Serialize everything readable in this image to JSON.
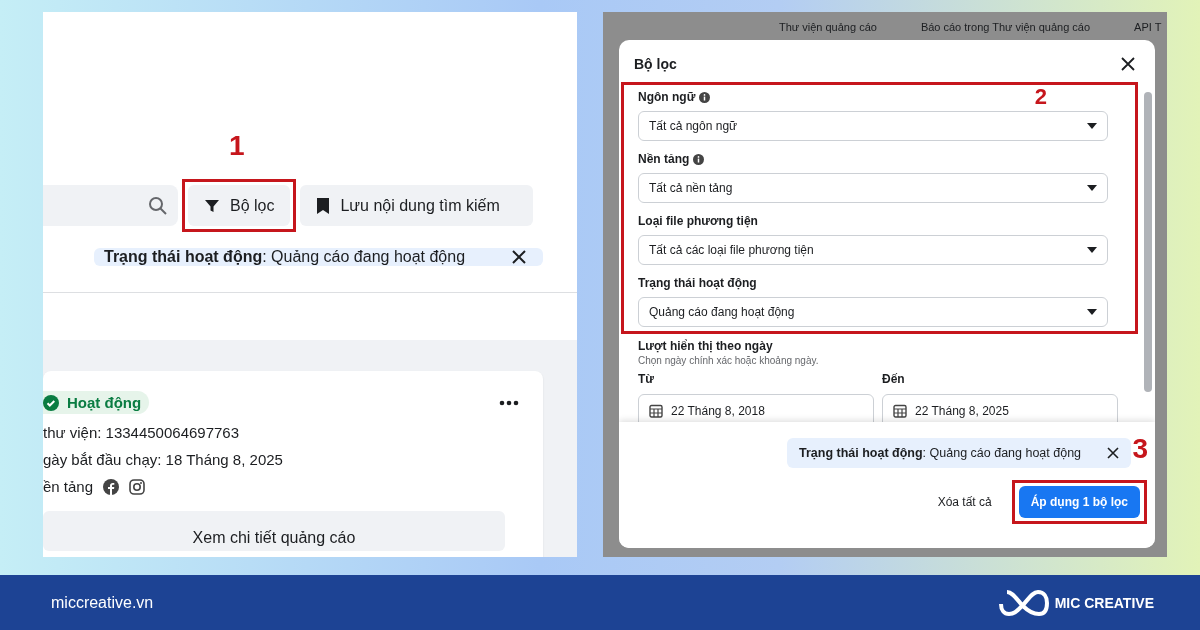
{
  "left_panel": {
    "filter_button": {
      "label": "Bộ lọc"
    },
    "save_search_button": {
      "label": "Lưu nội dung tìm kiếm"
    },
    "active_filter": {
      "text": "**Trạng thái hoạt động**: Quảng cáo đang hoạt động"
    },
    "ad_card": {
      "status": "Hoạt động",
      "library_id": "thư viện: 1334450064697763",
      "start_date": "gày bắt đầu chạy: 18 Tháng 8, 2025",
      "platforms_label": "ền tảng",
      "details_button": "Xem chi tiết quảng cáo"
    }
  },
  "right_panel": {
    "nav_links": [
      "Thư viện quảng cáo",
      "Báo cáo trong Thư viện quảng cáo",
      "API T"
    ],
    "modal": {
      "title": "Bộ lọc",
      "fields": [
        {
          "label": "Ngôn ngữ",
          "info": true,
          "value": "Tất cả ngôn ngữ"
        },
        {
          "label": "Nền tảng",
          "info": true,
          "value": "Tất cả nền tảng"
        },
        {
          "label": "Loại file phương tiện",
          "info": false,
          "value": "Tất cả các loại file phương tiện"
        },
        {
          "label": "Trạng thái hoạt động",
          "info": false,
          "value": "Quảng cáo đang hoạt động"
        }
      ],
      "date_section": {
        "title": "Lượt hiển thị theo ngày",
        "hint": "Chọn ngày chính xác hoặc khoảng ngày.",
        "from_label": "Từ",
        "from_value": "22 Tháng 8, 2018",
        "to_label": "Đến",
        "to_value": "22 Tháng 8, 2025"
      },
      "active_filter": {
        "text": "**Trạng thái hoạt động**: Quảng cáo đang hoạt động"
      },
      "clear_all": "Xóa tất cả",
      "apply_button": "Áp dụng 1 bộ lọc"
    }
  },
  "step_numbers": [
    "1",
    "2",
    "3"
  ],
  "footer": {
    "website": "miccreative.vn",
    "brand": "MIC CREATIVE"
  }
}
